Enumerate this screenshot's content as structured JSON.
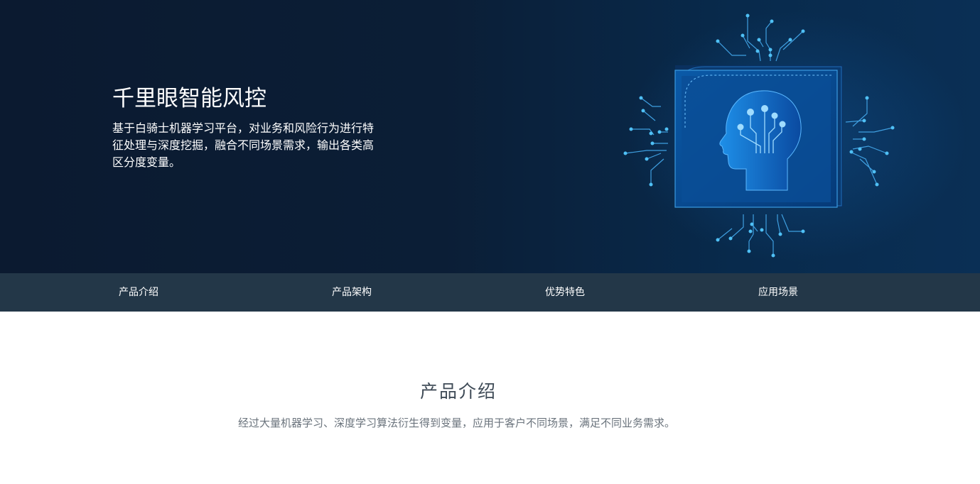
{
  "hero": {
    "title": "千里眼智能风控",
    "description": "基于白骑士机器学习平台，对业务和风险行为进行特征处理与深度挖掘，融合不同场景需求，输出各类高区分度变量。"
  },
  "subnav": {
    "items": [
      {
        "label": "产品介绍"
      },
      {
        "label": "产品架构"
      },
      {
        "label": "优势特色"
      },
      {
        "label": "应用场景"
      }
    ]
  },
  "intro": {
    "title": "产品介绍",
    "text": "经过大量机器学习、深度学习算法衍生得到变量，应用于客户不同场景，满足不同业务需求。"
  },
  "colors": {
    "hero_bg": "#0b1a30",
    "subnav_bg": "#233748",
    "accent": "#4fb8f0"
  },
  "icons": {
    "hero_illustration": "ai-head-chip-icon"
  }
}
